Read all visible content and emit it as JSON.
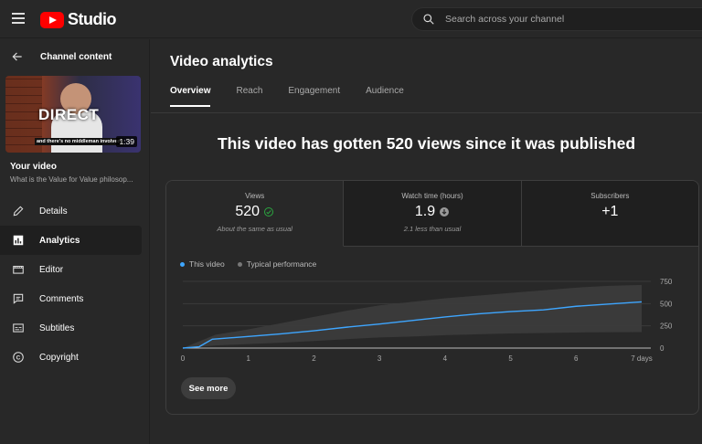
{
  "header": {
    "brand": "Studio",
    "search_placeholder": "Search across your channel"
  },
  "sidebar": {
    "back_label": "Channel content",
    "thumbnail": {
      "word": "DIRECT",
      "caption": "and there's no middleman involved.",
      "duration": "1:39"
    },
    "your_video_label": "Your video",
    "video_title": "What is the Value for Value philosop...",
    "items": [
      {
        "label": "Details",
        "icon": "pencil-icon",
        "active": false
      },
      {
        "label": "Analytics",
        "icon": "analytics-icon",
        "active": true
      },
      {
        "label": "Editor",
        "icon": "film-icon",
        "active": false
      },
      {
        "label": "Comments",
        "icon": "comment-icon",
        "active": false
      },
      {
        "label": "Subtitles",
        "icon": "subtitles-icon",
        "active": false
      },
      {
        "label": "Copyright",
        "icon": "copyright-icon",
        "active": false
      }
    ]
  },
  "main": {
    "title": "Video analytics",
    "tabs": [
      {
        "label": "Overview",
        "active": true
      },
      {
        "label": "Reach",
        "active": false
      },
      {
        "label": "Engagement",
        "active": false
      },
      {
        "label": "Audience",
        "active": false
      }
    ],
    "headline": "This video has gotten 520 views since it was published",
    "metrics": [
      {
        "label": "Views",
        "value": "520",
        "note": "About the same as usual",
        "status_icon": "check-circle-icon"
      },
      {
        "label": "Watch time (hours)",
        "value": "1.9",
        "note": "2.1 less than usual",
        "status_icon": "arrow-down-circle-icon"
      },
      {
        "label": "Subscribers",
        "value": "+1",
        "note": ""
      }
    ],
    "see_more_label": "See more"
  },
  "colors": {
    "accent": "#3ea6ff",
    "brand": "#ff0000",
    "check": "#2ba640",
    "band": "#3c3c3c"
  },
  "chart_data": {
    "type": "line",
    "series": [
      {
        "name": "This video",
        "x": [
          0,
          0.25,
          0.45,
          1,
          1.5,
          2,
          2.5,
          3,
          3.5,
          4,
          4.5,
          5,
          5.5,
          6,
          6.5,
          7
        ],
        "y": [
          0,
          15,
          100,
          130,
          160,
          195,
          235,
          270,
          310,
          350,
          385,
          410,
          430,
          470,
          495,
          520
        ]
      }
    ],
    "typical_performance": {
      "name": "Typical performance",
      "x": [
        0,
        0.5,
        1,
        1.5,
        2,
        2.5,
        3,
        3.5,
        4,
        4.5,
        5,
        5.5,
        6,
        6.5,
        7
      ],
      "low": [
        0,
        30,
        45,
        60,
        80,
        100,
        120,
        130,
        145,
        155,
        165,
        170,
        175,
        178,
        180
      ],
      "high": [
        0,
        150,
        210,
        280,
        350,
        420,
        480,
        520,
        560,
        590,
        620,
        650,
        680,
        700,
        710
      ]
    },
    "x_ticks": [
      "0",
      "1",
      "2",
      "3",
      "4",
      "5",
      "6",
      "7 days"
    ],
    "y_ticks": [
      0,
      250,
      500,
      750
    ],
    "xlim": [
      0,
      7
    ],
    "ylim": [
      0,
      750
    ],
    "grid": true,
    "legend_position": "top-left"
  }
}
